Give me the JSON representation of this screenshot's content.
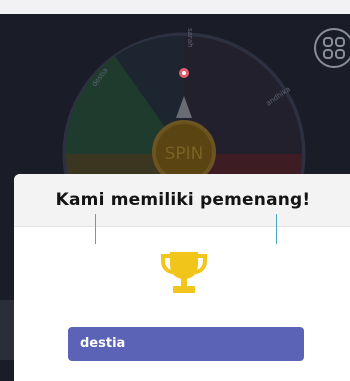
{
  "wheel": {
    "spin_label": "SPIN",
    "segment_labels": [
      "destia",
      "sarah",
      "andhika"
    ]
  },
  "modal": {
    "title": "Kami memiliki pemenang!",
    "winner_name": "destia"
  },
  "colors": {
    "winner_box": "#5b63b6",
    "trophy": "#f2c51b",
    "accent_button": "#f0a56a"
  },
  "icons": [
    "menu-grid-icon",
    "trophy-icon",
    "pointer-icon"
  ]
}
